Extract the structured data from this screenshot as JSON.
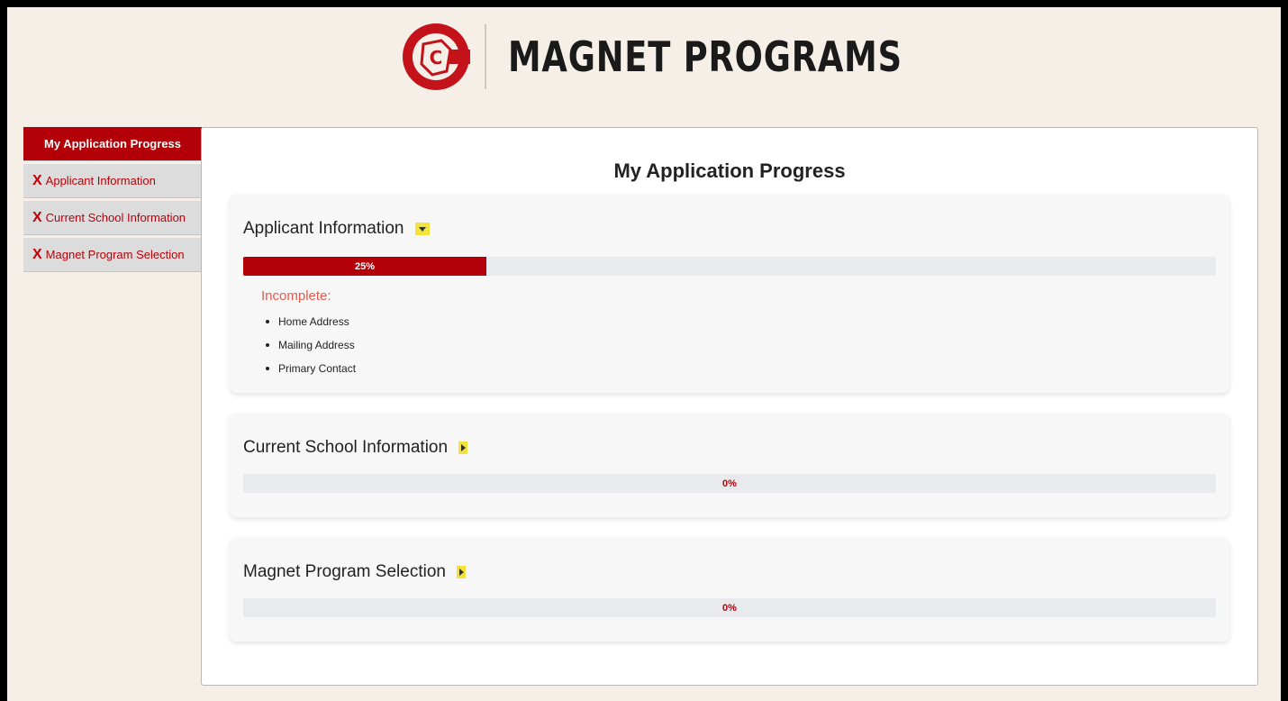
{
  "header": {
    "brand": "MAGNET PROGRAMS",
    "logo_letter": "C",
    "brand_color": "#b30008"
  },
  "sidebar": {
    "items": [
      {
        "label": "My Application Progress",
        "active": true,
        "icon": ""
      },
      {
        "label": "Applicant Information",
        "active": false,
        "icon": "X"
      },
      {
        "label": "Current School Information",
        "active": false,
        "icon": "X"
      },
      {
        "label": "Magnet Program Selection",
        "active": false,
        "icon": "X"
      }
    ]
  },
  "main": {
    "title": "My Application Progress",
    "sections": [
      {
        "title": "Applicant Information",
        "expanded": true,
        "progress": 25,
        "progress_label": "25%",
        "incomplete_title": "Incomplete:",
        "incomplete_items": [
          "Home Address",
          "Mailing Address",
          "Primary Contact"
        ]
      },
      {
        "title": "Current School Information",
        "expanded": false,
        "progress": 0,
        "progress_label": "0%"
      },
      {
        "title": "Magnet Program Selection",
        "expanded": false,
        "progress": 0,
        "progress_label": "0%"
      }
    ]
  },
  "colors": {
    "accent": "#b30008",
    "toggle": "#f2e23a",
    "incomplete": "#e05b4f",
    "background": "#f5efe8"
  },
  "icons": {
    "logo": "cps-logo-icon",
    "incomplete_marker": "x-mark-icon",
    "expanded_toggle": "caret-down-icon",
    "collapsed_toggle": "caret-right-icon"
  }
}
